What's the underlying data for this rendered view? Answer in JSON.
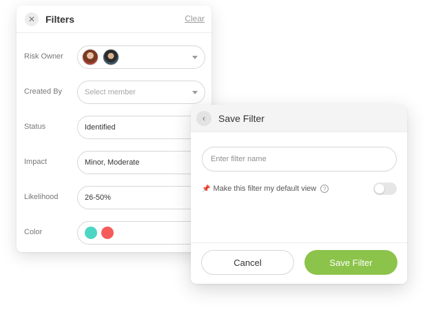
{
  "filters": {
    "title": "Filters",
    "clear_label": "Clear",
    "close_icon": "close-icon",
    "rows": [
      {
        "label": "Risk Owner",
        "type": "avatars",
        "avatars": [
          "avatar-woman",
          "avatar-man"
        ],
        "has_caret": true
      },
      {
        "label": "Created By",
        "type": "select",
        "placeholder": "Select member",
        "has_caret": true
      },
      {
        "label": "Status",
        "type": "text",
        "value": "Identified"
      },
      {
        "label": "Impact",
        "type": "text",
        "value": "Minor, Moderate"
      },
      {
        "label": "Likelihood",
        "type": "text",
        "value": "26-50%"
      },
      {
        "label": "Color",
        "type": "swatches",
        "colors": [
          "#4dd6c4",
          "#f55b5b"
        ]
      }
    ]
  },
  "save_filter": {
    "title": "Save Filter",
    "back_icon": "chevron-left-icon",
    "name_placeholder": "Enter filter name",
    "name_value": "",
    "default_view_label": "Make this filter my default view",
    "pin_icon": "pin-icon",
    "help_icon": "help-circle-icon",
    "default_view_enabled": false,
    "cancel_label": "Cancel",
    "save_label": "Save Filter",
    "accent_color": "#8cc34a"
  }
}
